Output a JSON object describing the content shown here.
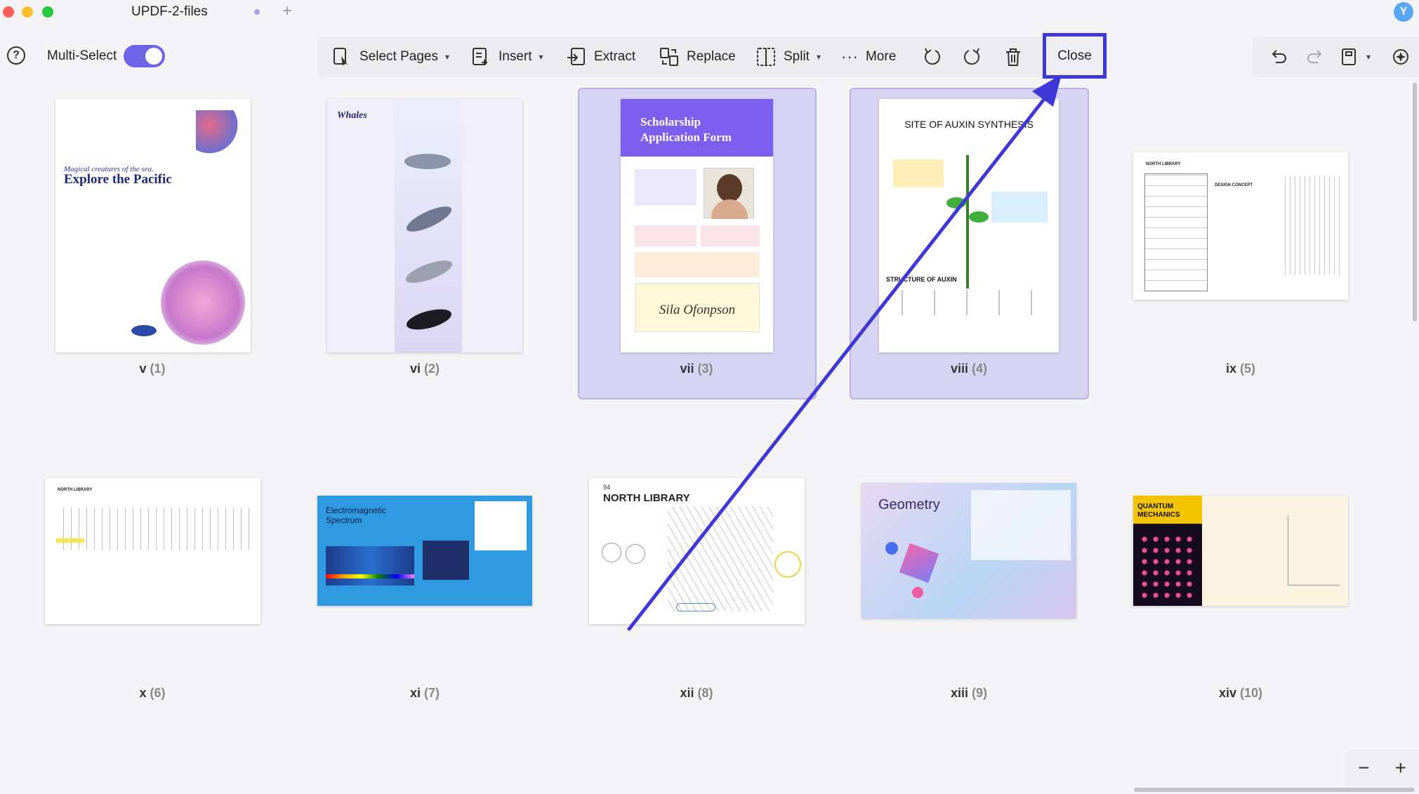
{
  "window": {
    "tab_title": "UPDF-2-files",
    "new_tab": "+",
    "user_initial": "Y"
  },
  "toolbar": {
    "multi_select_label": "Multi-Select",
    "multi_select_on": true,
    "select_pages": "Select Pages",
    "insert": "Insert",
    "extract": "Extract",
    "replace": "Replace",
    "split": "Split",
    "more": "More",
    "close": "Close"
  },
  "pages": [
    {
      "roman": "v",
      "num": "(1)",
      "selected": false,
      "title": "Explore the Pacific",
      "subtitle": "Magical creatures of the sea."
    },
    {
      "roman": "vi",
      "num": "(2)",
      "selected": false,
      "title": "Whales"
    },
    {
      "roman": "vii",
      "num": "(3)",
      "selected": true,
      "title": "Scholarship Application Form",
      "signature": "Sila Ofonpson"
    },
    {
      "roman": "viii",
      "num": "(4)",
      "selected": true,
      "title": "SITE OF AUXIN SYNTHESIS",
      "subtitle": "STRUCTURE OF AUXIN"
    },
    {
      "roman": "ix",
      "num": "(5)",
      "selected": false,
      "title": "NORTH LIBRARY",
      "subtitle": "DESIGN CONCEPT"
    },
    {
      "roman": "x",
      "num": "(6)",
      "selected": false,
      "title": "NORTH LIBRARY"
    },
    {
      "roman": "xi",
      "num": "(7)",
      "selected": false,
      "title": "Electromagnetic Spectrum"
    },
    {
      "roman": "xii",
      "num": "(8)",
      "selected": false,
      "title": "NORTH LIBRARY",
      "page_no": "94"
    },
    {
      "roman": "xiii",
      "num": "(9)",
      "selected": false,
      "title": "Geometry"
    },
    {
      "roman": "xiv",
      "num": "(10)",
      "selected": false,
      "title": "QUANTUM MECHANICS"
    }
  ],
  "zoom": {
    "minus": "−",
    "plus": "+"
  },
  "colors": {
    "accent": "#6f64e8",
    "highlight": "#3f38d6",
    "selection": "#d6d4f3"
  }
}
